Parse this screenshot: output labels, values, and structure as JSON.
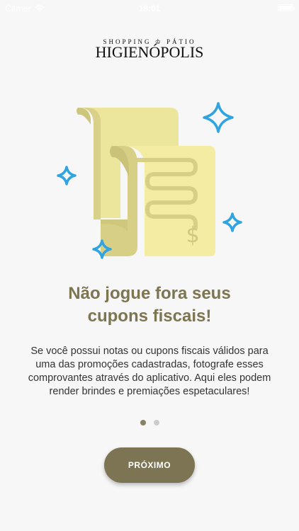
{
  "status_bar": {
    "carrier": "Carrier",
    "time": "18:01"
  },
  "logo": {
    "subtitle": "SHOPPING ♔ PÁTIO",
    "name": "HIGIENÓPOLIS"
  },
  "onboarding": {
    "headline_line1": "Não jogue fora seus",
    "headline_line2": "cupons fiscais!",
    "description": "Se você possui notas ou cupons fiscais válidos para uma das promoções cadastradas, fotografe esses comprovantes através do aplicativo. Aqui eles podem render brindes e premiações espetaculares!",
    "pages": 2,
    "current_page": 1,
    "next_label": "PRÓXIMO"
  },
  "colors": {
    "accent": "#7d7454",
    "sparkle": "#2fa4e0",
    "receipt": "#f3eca2"
  },
  "icons": [
    "wifi-icon",
    "battery-icon",
    "receipt-illustration",
    "sparkle-icon",
    "dollar-icon"
  ]
}
